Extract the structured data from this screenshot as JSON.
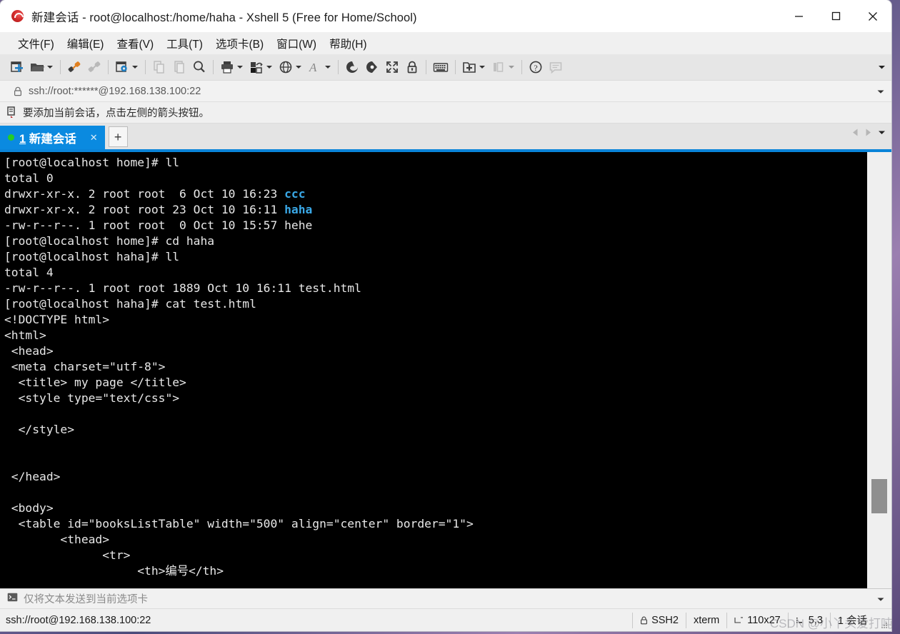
{
  "window": {
    "title": "新建会话 - root@localhost:/home/haha - Xshell 5 (Free for Home/School)",
    "app_icon": "xshell-icon",
    "minimize_label": "最小化",
    "maximize_label": "最大化",
    "close_label": "关闭"
  },
  "menu": {
    "items": [
      {
        "label": "文件(F)",
        "name": "menu-file"
      },
      {
        "label": "编辑(E)",
        "name": "menu-edit"
      },
      {
        "label": "查看(V)",
        "name": "menu-view"
      },
      {
        "label": "工具(T)",
        "name": "menu-tools"
      },
      {
        "label": "选项卡(B)",
        "name": "menu-tabs"
      },
      {
        "label": "窗口(W)",
        "name": "menu-window"
      },
      {
        "label": "帮助(H)",
        "name": "menu-help"
      }
    ]
  },
  "toolbar": {
    "items": [
      {
        "icon": "new-session-icon",
        "disabled": false,
        "caret": false
      },
      {
        "icon": "open-folder-icon",
        "disabled": false,
        "caret": true
      },
      {
        "sep": true
      },
      {
        "icon": "connect-plug-icon",
        "disabled": false,
        "caret": false
      },
      {
        "icon": "disconnect-plug-icon",
        "disabled": true,
        "caret": false
      },
      {
        "sep": true
      },
      {
        "icon": "session-properties-icon",
        "disabled": false,
        "caret": true
      },
      {
        "sep": true
      },
      {
        "icon": "copy-icon",
        "disabled": true,
        "caret": false
      },
      {
        "icon": "paste-icon",
        "disabled": true,
        "caret": false
      },
      {
        "icon": "find-icon",
        "disabled": false,
        "caret": false
      },
      {
        "sep": true
      },
      {
        "icon": "print-icon",
        "disabled": false,
        "caret": true
      },
      {
        "icon": "file-transfer-icon",
        "disabled": false,
        "caret": true
      },
      {
        "icon": "globe-icon",
        "disabled": false,
        "caret": true
      },
      {
        "icon": "font-icon",
        "disabled": false,
        "caret": true
      },
      {
        "sep": true
      },
      {
        "icon": "xshell-icon",
        "disabled": false,
        "caret": false
      },
      {
        "icon": "xftp-icon",
        "disabled": false,
        "caret": false
      },
      {
        "icon": "fullscreen-icon",
        "disabled": false,
        "caret": false
      },
      {
        "icon": "lock-icon",
        "disabled": false,
        "caret": false
      },
      {
        "sep": true
      },
      {
        "icon": "keyboard-icon",
        "disabled": false,
        "caret": false
      },
      {
        "sep": true
      },
      {
        "icon": "add-to-folder-icon",
        "disabled": false,
        "caret": true
      },
      {
        "icon": "layout-icon",
        "disabled": true,
        "caret": true
      },
      {
        "sep": true
      },
      {
        "icon": "help-icon",
        "disabled": false,
        "caret": false
      },
      {
        "icon": "feedback-icon",
        "disabled": true,
        "caret": false
      }
    ],
    "overflow_icon": "chevron-down-icon"
  },
  "address": {
    "icon": "lock-icon",
    "value": "ssh://root:******@192.168.138.100:22",
    "dropdown_icon": "chevron-down-icon"
  },
  "hint": {
    "icon": "session-manager-icon",
    "text": "要添加当前会话，点击左侧的箭头按钮。"
  },
  "tabs": {
    "items": [
      {
        "index": "1",
        "label": "新建会话",
        "active": true,
        "status_dot": "connected"
      }
    ],
    "close_icon": "close-icon",
    "add_label": "+",
    "nav_prev_icon": "chevron-left-icon",
    "nav_next_icon": "chevron-right-icon",
    "nav_menu_icon": "chevron-down-icon"
  },
  "terminal": {
    "lines": [
      [
        {
          "t": "[root@localhost home]# ll"
        }
      ],
      [
        {
          "t": "total 0"
        }
      ],
      [
        {
          "t": "drwxr-xr-x. 2 root root  6 Oct 10 16:23 "
        },
        {
          "t": "ccc",
          "c": "dir"
        }
      ],
      [
        {
          "t": "drwxr-xr-x. 2 root root 23 Oct 10 16:11 "
        },
        {
          "t": "haha",
          "c": "dir"
        }
      ],
      [
        {
          "t": "-rw-r--r--. 1 root root  0 Oct 10 15:57 hehe"
        }
      ],
      [
        {
          "t": "[root@localhost home]# cd haha"
        }
      ],
      [
        {
          "t": "[root@localhost haha]# ll"
        }
      ],
      [
        {
          "t": "total 4"
        }
      ],
      [
        {
          "t": "-rw-r--r--. 1 root root 1889 Oct 10 16:11 test.html"
        }
      ],
      [
        {
          "t": "[root@localhost haha]# cat test.html"
        }
      ],
      [
        {
          "t": "<!DOCTYPE html>"
        }
      ],
      [
        {
          "t": "<html>"
        }
      ],
      [
        {
          "t": " <head>"
        }
      ],
      [
        {
          "t": " <meta charset=\"utf-8\">"
        }
      ],
      [
        {
          "t": "  <title> my page </title>"
        }
      ],
      [
        {
          "t": "  <style type=\"text/css\">"
        }
      ],
      [
        {
          "t": ""
        }
      ],
      [
        {
          "t": "  </style>"
        }
      ],
      [
        {
          "t": ""
        }
      ],
      [
        {
          "t": ""
        }
      ],
      [
        {
          "t": " </head>"
        }
      ],
      [
        {
          "t": ""
        }
      ],
      [
        {
          "t": " <body>"
        }
      ],
      [
        {
          "t": "  <table id=\"booksListTable\" width=\"500\" align=\"center\" border=\"1\">"
        }
      ],
      [
        {
          "t": "        <thead>"
        }
      ],
      [
        {
          "t": "              <tr>"
        }
      ],
      [
        {
          "t": "                   <th>编号</th>"
        }
      ]
    ],
    "colors": {
      "fg": "#e8e8e8",
      "bg": "#000000",
      "dir": "#3aa9e8"
    }
  },
  "sendbar": {
    "icon": "terminal-prompt-icon",
    "placeholder": "仅将文本发送到当前选项卡",
    "value": "",
    "dropdown_icon": "chevron-down-icon"
  },
  "statusbar": {
    "connection": "ssh://root@192.168.138.100:22",
    "cells": [
      {
        "icon": "lock-icon",
        "label": "SSH2",
        "name": "status-protocol"
      },
      {
        "icon": "",
        "label": "xterm",
        "name": "status-terminal-type"
      },
      {
        "icon": "resize-icon",
        "label": "110x27",
        "name": "status-dimensions"
      },
      {
        "icon": "cursor-icon",
        "label": "5,3",
        "name": "status-cursor-position"
      },
      {
        "icon": "",
        "label": "1 会话",
        "name": "status-session-count"
      }
    ],
    "grip_icon": "resize-grip-icon"
  },
  "watermark": {
    "text": "CSDN @小丫头爱打吨"
  }
}
